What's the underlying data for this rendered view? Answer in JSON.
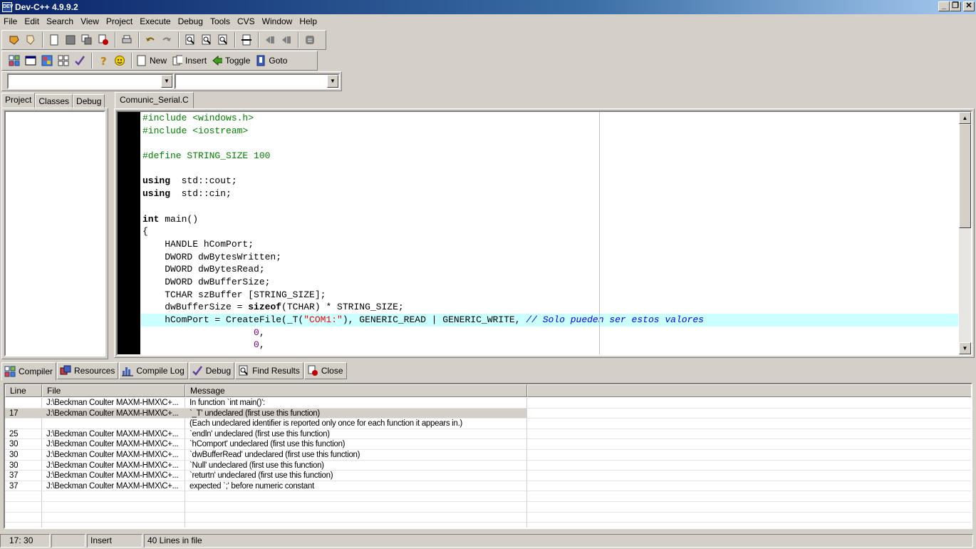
{
  "window": {
    "title": "Dev-C++ 4.9.9.2"
  },
  "menu": [
    "File",
    "Edit",
    "Search",
    "View",
    "Project",
    "Execute",
    "Debug",
    "Tools",
    "CVS",
    "Window",
    "Help"
  ],
  "toolbar2": {
    "new_label": "New",
    "insert_label": "Insert",
    "toggle_label": "Toggle",
    "goto_label": "Goto"
  },
  "left_tabs": [
    "Project",
    "Classes",
    "Debug"
  ],
  "editor": {
    "tab_label": "Comunic_Serial.C",
    "lines": [
      [
        [
          "pp",
          "#include <windows.h>"
        ]
      ],
      [
        [
          "pp",
          "#include <iostream>"
        ]
      ],
      [],
      [
        [
          "pp",
          "#define STRING_SIZE 100"
        ]
      ],
      [],
      [
        [
          "kw",
          "using"
        ],
        [
          "",
          "  std::cout;"
        ]
      ],
      [
        [
          "kw",
          "using"
        ],
        [
          "",
          "  std::cin;"
        ]
      ],
      [],
      [
        [
          "kw",
          "int"
        ],
        [
          "",
          " main()"
        ]
      ],
      [
        [
          "",
          "{"
        ]
      ],
      [
        [
          "",
          "    HANDLE hComPort;"
        ]
      ],
      [
        [
          "",
          "    DWORD dwBytesWritten;"
        ]
      ],
      [
        [
          "",
          "    DWORD dwBytesRead;"
        ]
      ],
      [
        [
          "",
          "    DWORD dwBufferSize;"
        ]
      ],
      [
        [
          "",
          "    TCHAR szBuffer [STRING_SIZE];"
        ]
      ],
      [
        [
          "",
          "    dwBufferSize = "
        ],
        [
          "kw",
          "sizeof"
        ],
        [
          "",
          "(TCHAR) * STRING_SIZE;"
        ]
      ],
      [
        [
          "",
          "    hComPort = CreateFile(_T("
        ],
        [
          "str",
          "\"COM1:\""
        ],
        [
          "",
          "), GENERIC_READ | GENERIC_WRITE, "
        ],
        [
          "cmt",
          "// Solo pueden ser estos valores"
        ]
      ],
      [
        [
          "",
          "                    "
        ],
        [
          "num",
          "0"
        ],
        [
          "",
          ","
        ]
      ],
      [
        [
          "",
          "                    "
        ],
        [
          "num",
          "0"
        ],
        [
          "",
          ","
        ]
      ]
    ],
    "highlight_line": 16
  },
  "bottom_tabs": [
    "Compiler",
    "Resources",
    "Compile Log",
    "Debug",
    "Find Results",
    "Close"
  ],
  "messages": {
    "headers": [
      "Line",
      "File",
      "Message"
    ],
    "rows": [
      {
        "line": "",
        "file": "J:\\Beckman Coulter MAXM-HMX\\C+...",
        "message": "In function `int main()':"
      },
      {
        "line": "17",
        "file": "J:\\Beckman Coulter MAXM-HMX\\C+...",
        "message": "`_T' undeclared (first use this function)"
      },
      {
        "line": "",
        "file": "",
        "message": "(Each undeclared identifier is reported only once for each function it appears in.)"
      },
      {
        "line": "25",
        "file": "J:\\Beckman Coulter MAXM-HMX\\C+...",
        "message": "`endln' undeclared (first use this function)"
      },
      {
        "line": "30",
        "file": "J:\\Beckman Coulter MAXM-HMX\\C+...",
        "message": "`hComport' undeclared (first use this function)"
      },
      {
        "line": "30",
        "file": "J:\\Beckman Coulter MAXM-HMX\\C+...",
        "message": "`dwBufferRead' undeclared (first use this function)"
      },
      {
        "line": "30",
        "file": "J:\\Beckman Coulter MAXM-HMX\\C+...",
        "message": "`Null' undeclared (first use this function)"
      },
      {
        "line": "37",
        "file": "J:\\Beckman Coulter MAXM-HMX\\C+...",
        "message": "`returtn' undeclared (first use this function)"
      },
      {
        "line": "37",
        "file": "J:\\Beckman Coulter MAXM-HMX\\C+...",
        "message": "expected `;' before numeric constant"
      },
      {
        "line": "",
        "file": "",
        "message": ""
      },
      {
        "line": "",
        "file": "",
        "message": ""
      },
      {
        "line": "",
        "file": "",
        "message": ""
      },
      {
        "line": "",
        "file": "",
        "message": ""
      }
    ],
    "selected_row": 1
  },
  "status": {
    "position": "17: 30",
    "modified": "",
    "mode": "Insert",
    "lines_info": "40 Lines in file"
  },
  "colors": {
    "title_start": "#0a246a",
    "highlight": "#ccffff",
    "preprocessor": "#008000",
    "comment": "#0000ff",
    "string": "#ff0000",
    "number": "#800080"
  }
}
